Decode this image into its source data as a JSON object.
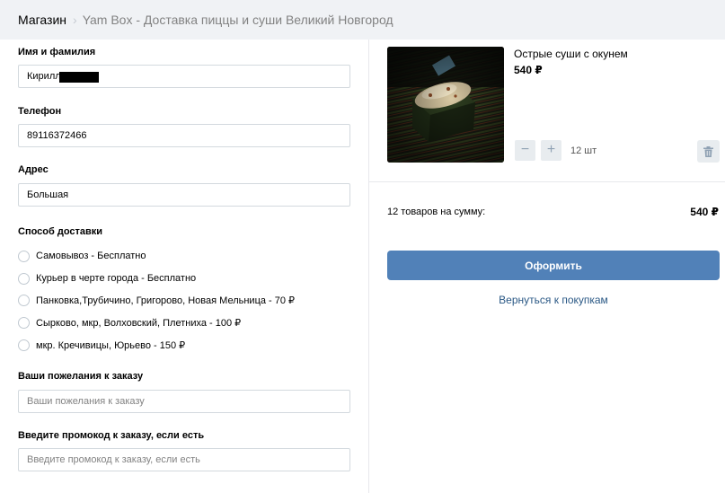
{
  "header": {
    "root": "Магазин",
    "title": "Yam Box - Доставка пиццы и суши Великий Новгород"
  },
  "form": {
    "name": {
      "label": "Имя и фамилия",
      "value": "Кирилл"
    },
    "phone": {
      "label": "Телефон",
      "value": "89116372466"
    },
    "address": {
      "label": "Адрес",
      "value": "Большая"
    },
    "delivery": {
      "label": "Способ доставки",
      "options": [
        "Самовывоз - Бесплатно",
        "Курьер в черте города - Бесплатно",
        "Панковка,Трубичино, Григорово, Новая Мельница - 70 ₽",
        "Сырково, мкр, Волховский, Плетниха - 100 ₽",
        "мкр. Кречивицы, Юрьево - 150 ₽"
      ]
    },
    "wishes": {
      "label": "Ваши пожелания к заказу",
      "placeholder": "Ваши пожелания к заказу"
    },
    "promo": {
      "label": "Введите промокод к заказу, если есть",
      "placeholder": "Введите промокод к заказу, если есть"
    }
  },
  "cart": {
    "product": {
      "name": "Острые суши с окунем",
      "price": "540 ₽",
      "quantity": "12 шт",
      "minus": "−",
      "plus": "+"
    },
    "summary_label": "12 товаров на сумму:",
    "summary_total": "540 ₽",
    "checkout_label": "Оформить",
    "back_label": "Вернуться к покупкам"
  },
  "colors": {
    "accent": "#5181b8",
    "link": "#2a5885",
    "header_bg": "#f0f2f5"
  }
}
